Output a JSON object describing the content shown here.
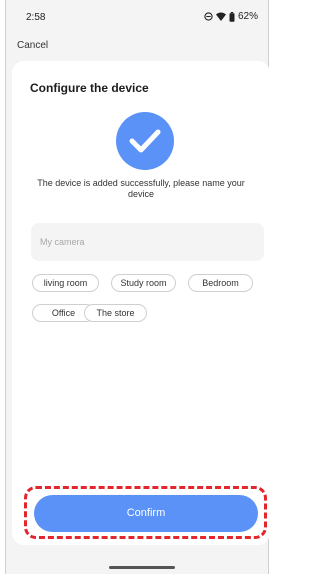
{
  "status_bar": {
    "time": "2:58",
    "battery": "62%",
    "icons": [
      "do-not-disturb-icon",
      "wifi-icon",
      "battery-icon"
    ]
  },
  "header": {
    "cancel_label": "Cancel"
  },
  "card": {
    "title": "Configure the device",
    "success_message": "The device is added successfully, please name your device",
    "name_input": {
      "value": "",
      "placeholder": "My camera"
    },
    "chips": [
      "living room",
      "Study room",
      "Bedroom",
      "Office",
      "The store"
    ]
  },
  "confirm_label": "Confirm",
  "colors": {
    "accent": "#5b92f7",
    "highlight": "#e2262c"
  }
}
